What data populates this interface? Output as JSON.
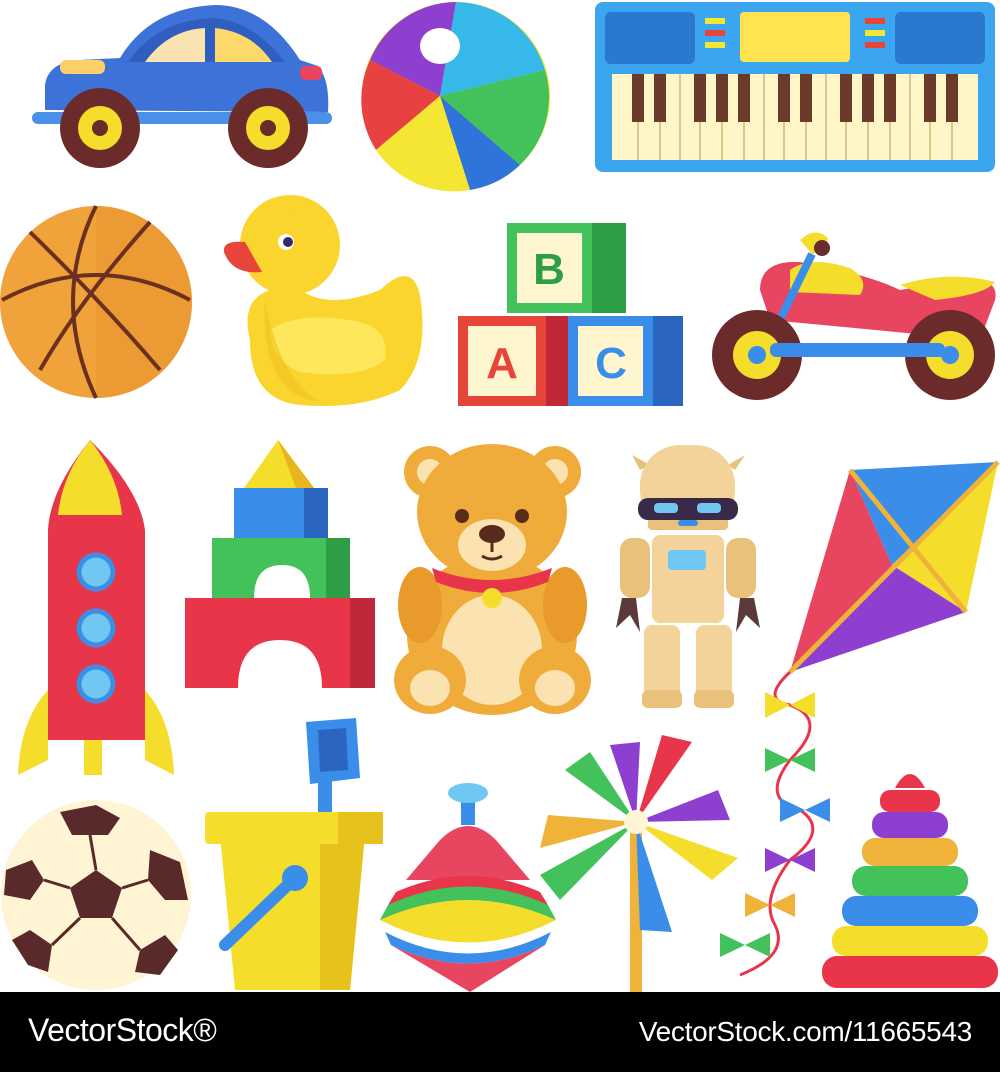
{
  "footer": {
    "brand": "VectorStock®",
    "image_id": "VectorStock.com/11665543"
  },
  "blocks": {
    "letter_a": "A",
    "letter_b": "B",
    "letter_c": "C"
  },
  "icons": [
    "toy-car-icon",
    "beach-ball-icon",
    "toy-keyboard-icon",
    "basketball-icon",
    "rubber-duck-icon",
    "abc-blocks-icon",
    "toy-motorcycle-icon",
    "rocket-icon",
    "building-blocks-icon",
    "teddy-bear-icon",
    "robot-icon",
    "kite-icon",
    "soccer-ball-icon",
    "sand-bucket-icon",
    "spinning-top-icon",
    "pinwheel-icon",
    "stacking-rings-icon"
  ],
  "colors": {
    "background": "#ffffff",
    "footer_bg": "#000000",
    "footer_text": "#ffffff"
  }
}
